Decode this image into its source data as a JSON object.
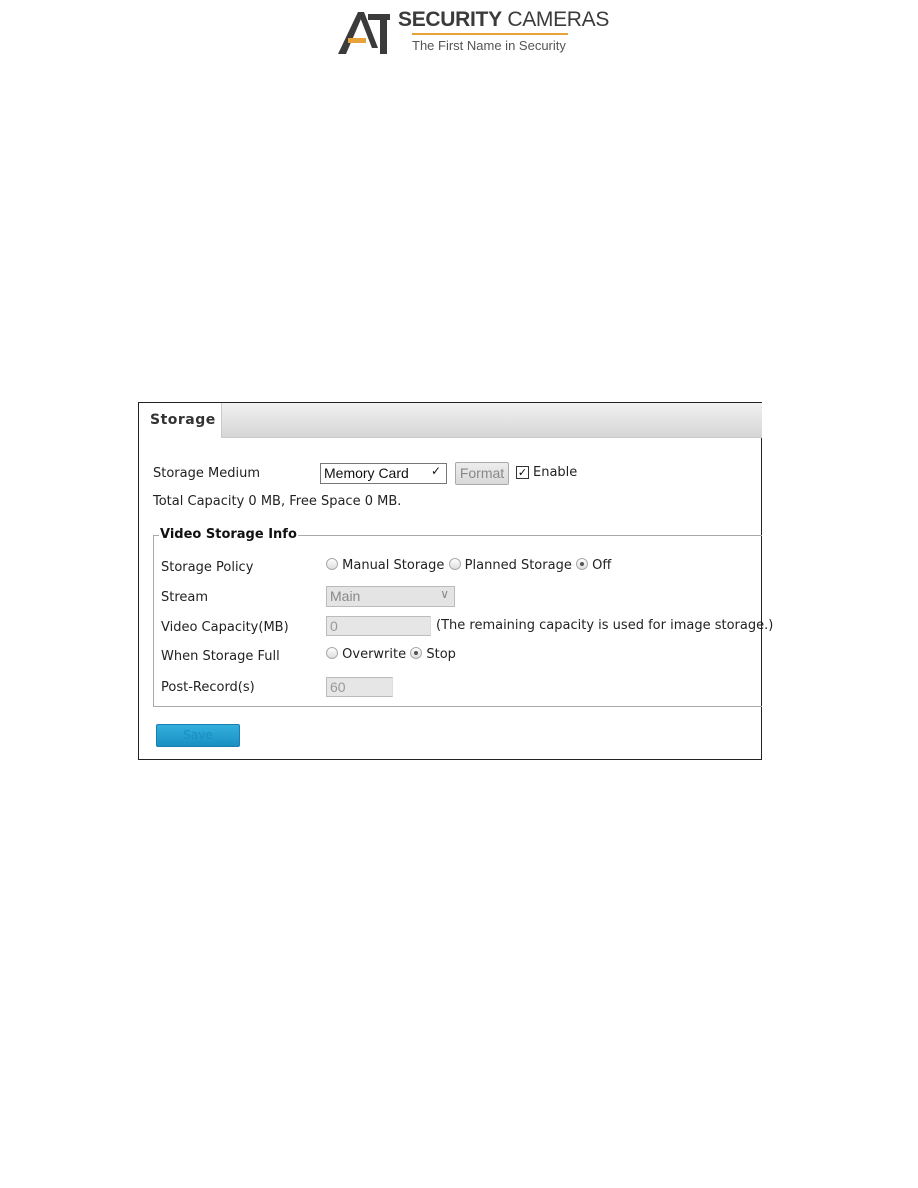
{
  "logo": {
    "brand": "SECURITY CAMERAS",
    "brand_bold": "SECURITY",
    "brand_rest": "CAMERAS",
    "mark": "A1",
    "tagline": "The First Name in Security",
    "accent": "#e8a23a"
  },
  "tab": {
    "label": "Storage"
  },
  "storage_medium": {
    "label": "Storage Medium",
    "value": "Memory Card",
    "format_label": "Format",
    "enable_label": "Enable",
    "enabled": true
  },
  "capacity_text": "Total Capacity 0 MB, Free Space 0 MB.",
  "video_info": {
    "legend": "Video Storage Info",
    "policy": {
      "label": "Storage Policy",
      "options": [
        "Manual Storage",
        "Planned Storage",
        "Off"
      ],
      "selected": "Off"
    },
    "stream": {
      "label": "Stream",
      "value": "Main"
    },
    "video_capacity": {
      "label": "Video Capacity(MB)",
      "value": "0",
      "note": "(The remaining capacity is used for image storage.)"
    },
    "when_full": {
      "label": "When Storage Full",
      "options": [
        "Overwrite",
        "Stop"
      ],
      "selected": "Stop"
    },
    "post_record": {
      "label": "Post-Record(s)",
      "value": "60"
    }
  },
  "save_label": "Save",
  "colors": {
    "save_button": "#1a8fc2"
  }
}
